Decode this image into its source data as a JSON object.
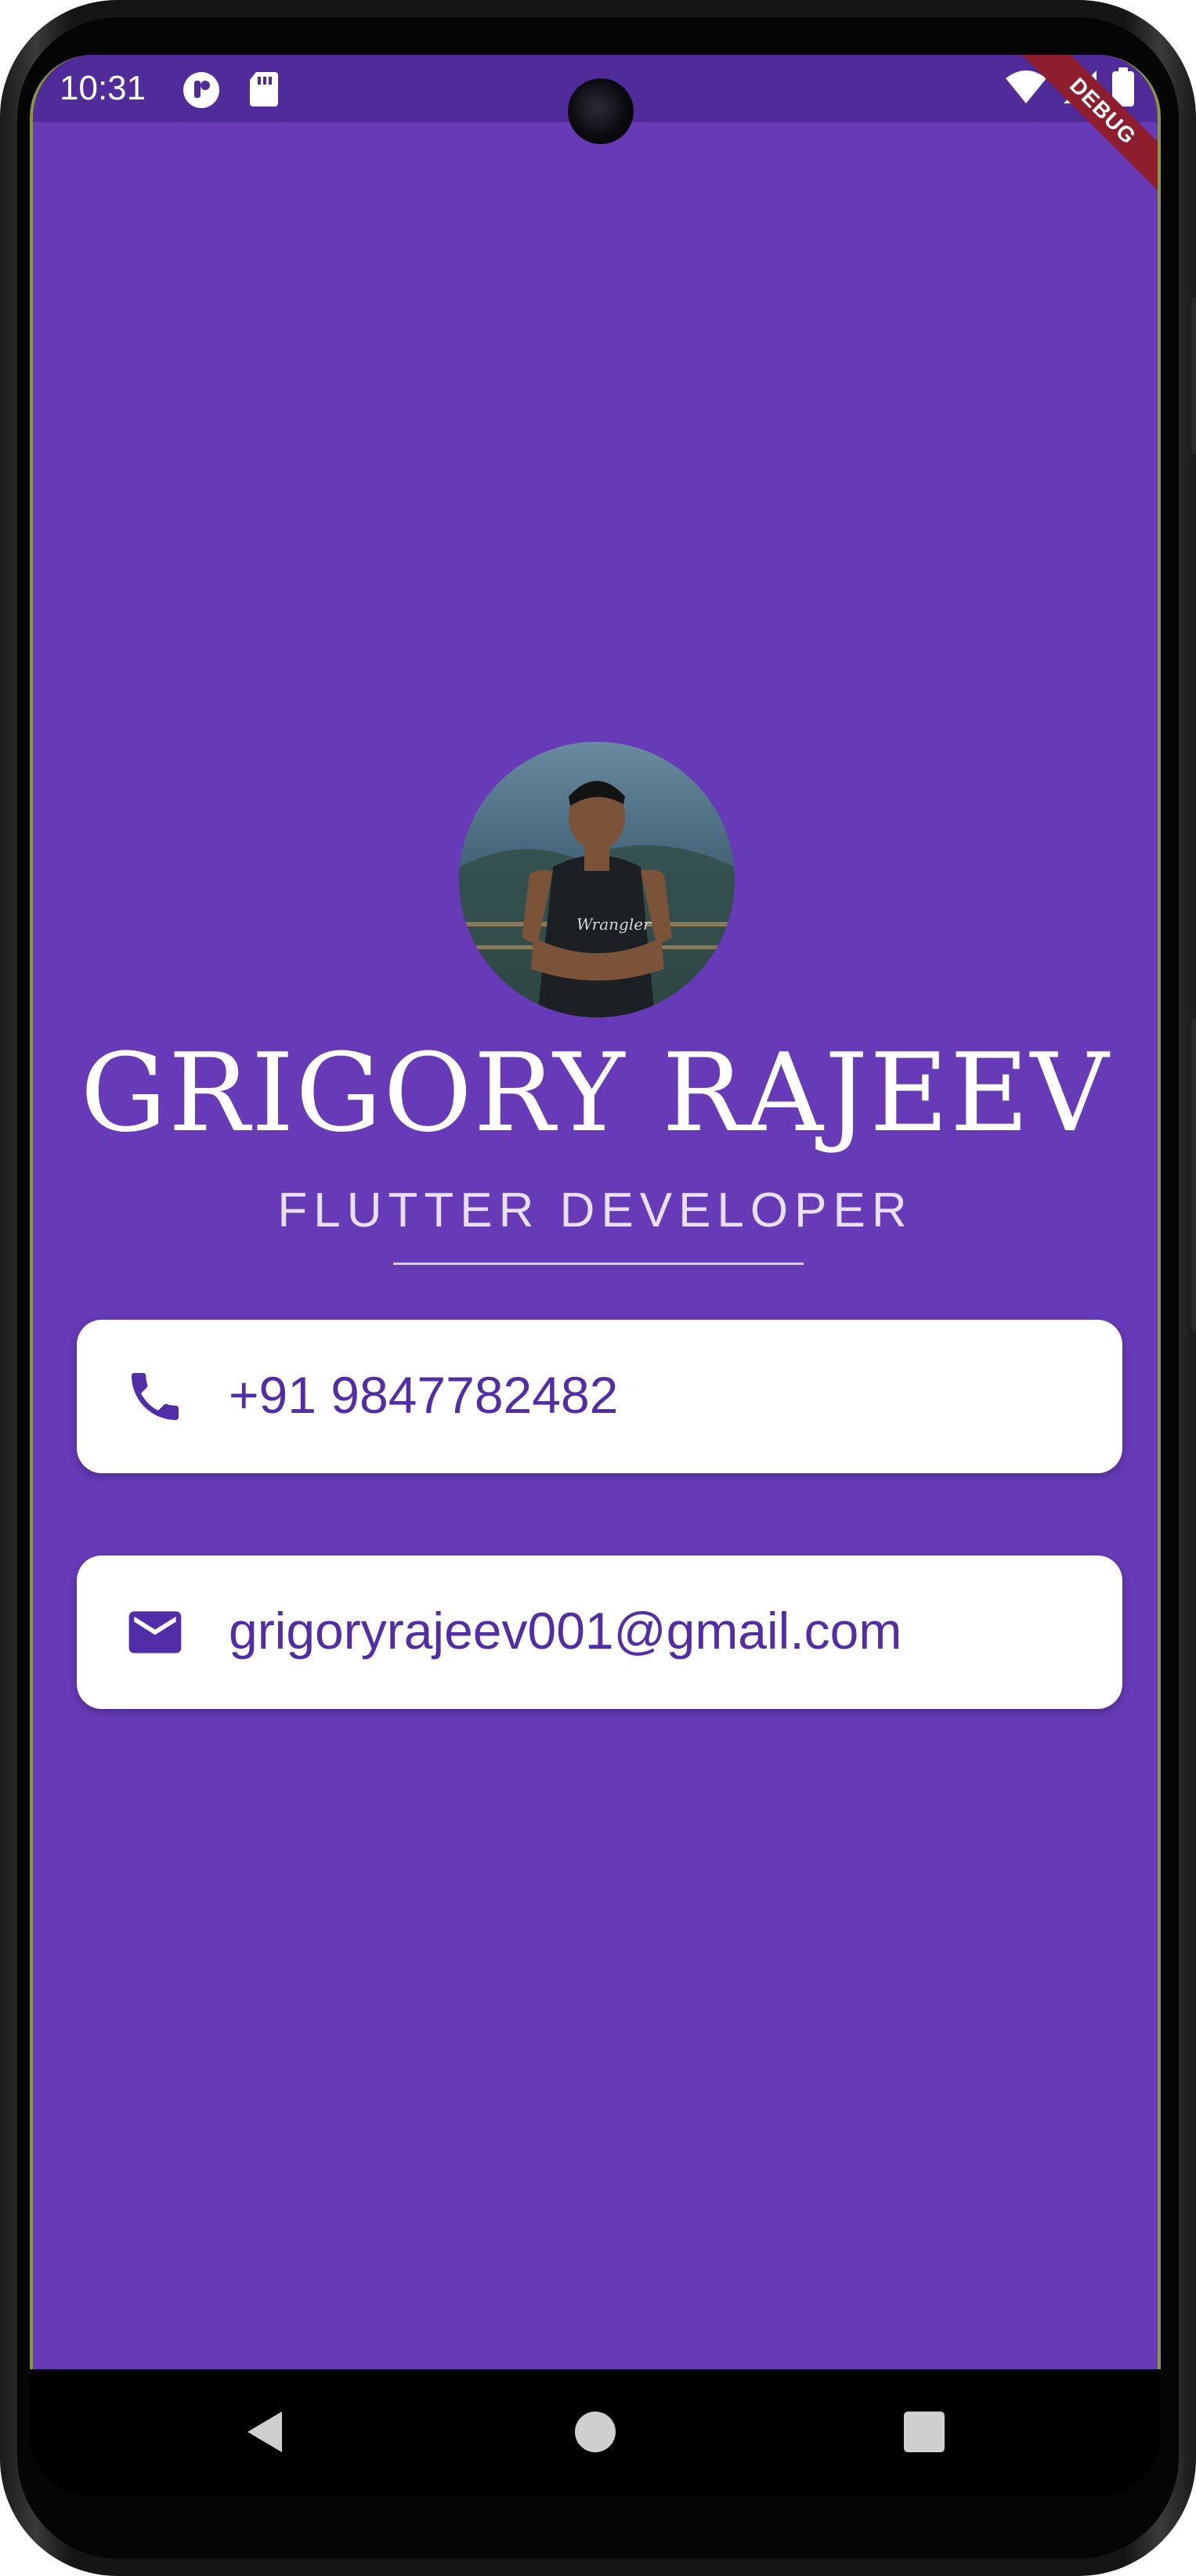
{
  "status_bar": {
    "time": "10:31",
    "left_icons": [
      "notification-icon",
      "sd-card-icon"
    ],
    "right_icons": [
      "wifi-icon",
      "cellular-signal-icon",
      "battery-icon"
    ],
    "background": "#4f2c9a"
  },
  "debug_banner": {
    "label": "DEBUG",
    "color": "#8e1e2e"
  },
  "profile": {
    "avatar_description": "profile-photo",
    "name": "GRIGORY RAJEEV",
    "title": "FLUTTER DEVELOPER"
  },
  "contacts": [
    {
      "icon": "phone-icon",
      "text": "+91 9847782482"
    },
    {
      "icon": "mail-icon",
      "text": "grigoryrajeev001@gmail.com"
    }
  ],
  "navigation": {
    "buttons": [
      "back-icon",
      "home-icon",
      "recents-icon"
    ]
  },
  "colors": {
    "background": "#673ab7",
    "card": "#ffffff",
    "card_text": "#512da8",
    "name_text": "#ffffff"
  }
}
